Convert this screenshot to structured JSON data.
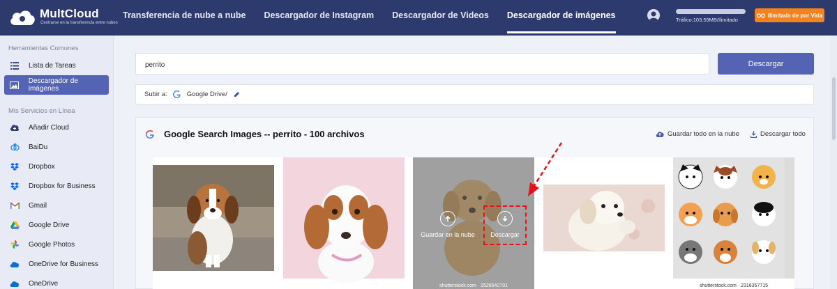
{
  "brand": {
    "name": "MultCloud",
    "tagline": "Centrarse en la transferencia entre nubes"
  },
  "nav": {
    "items": [
      {
        "label": "Transferencia de nube a nube",
        "active": false
      },
      {
        "label": "Descargador de Instagram",
        "active": false
      },
      {
        "label": "Descargador de Videos",
        "active": false
      },
      {
        "label": "Descargador de imágenes",
        "active": true
      }
    ]
  },
  "account": {
    "traffic": "Tráfico:103.59MB/Ilimitado",
    "plan_label": "Ilimitado de por Vida"
  },
  "sidebar": {
    "section1": "Herramientas Comunes",
    "common": [
      {
        "label": "Lista de Tareas",
        "icon": "task-list-icon",
        "active": false
      },
      {
        "label": "Descargador de imágenes",
        "icon": "image-icon",
        "active": true
      }
    ],
    "section2": "Mis Servicios en Línea",
    "services": [
      {
        "label": "Añadir Cloud",
        "icon": "add-cloud-icon"
      },
      {
        "label": "BaiDu",
        "icon": "baidu-icon"
      },
      {
        "label": "Dropbox",
        "icon": "dropbox-icon"
      },
      {
        "label": "Dropbox for Business",
        "icon": "dropbox-business-icon"
      },
      {
        "label": "Gmail",
        "icon": "gmail-icon"
      },
      {
        "label": "Google Drive",
        "icon": "google-drive-icon"
      },
      {
        "label": "Google Photos",
        "icon": "google-photos-icon"
      },
      {
        "label": "OneDrive for Business",
        "icon": "onedrive-business-icon"
      },
      {
        "label": "OneDrive",
        "icon": "onedrive-icon"
      }
    ]
  },
  "search": {
    "value": "perrito",
    "button": "Descargar"
  },
  "upload": {
    "label": "Subir a:",
    "target": "Google Drive/"
  },
  "results": {
    "title": "Google Search Images -- perrito - 100 archivos",
    "save_all": "Guardar todo en la nube",
    "download_all": "Descargar todo",
    "overlay_save": "Guardar en la nube",
    "overlay_download": "Descargar",
    "credits": [
      "shutterstock.com · 2526542701",
      "shutterstock.com · 2316357715"
    ]
  },
  "colors": {
    "topbar": "#2c3a6e",
    "accent": "#5563b5",
    "plan": "#f5821f",
    "highlight": "#e8101a"
  }
}
